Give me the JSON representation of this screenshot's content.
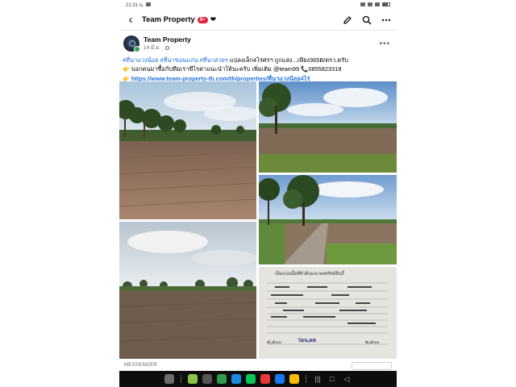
{
  "status_bar": {
    "time": "21:31 น."
  },
  "app_bar": {
    "title": "Team Property",
    "badge": "9+",
    "heart": "❤"
  },
  "post": {
    "author": "Team Property",
    "date": "14 มิ.ย.",
    "more": "•••",
    "hashtags": [
      "#ที่นาแวงน้อย",
      "#ที่นาขอนแก่น",
      "#ที่นาสวยๆ"
    ],
    "line1_text": " แปลงเล็ก4ไร่ศรฯ ถูกแสง...เพียง365B/ตรว.ครับ",
    "line2_prefix": "👉",
    "line2_text": "บอกคนมาซื้อกับทีมเราขีไรค่าแนะนำให้นะครับ เพิ่มเติม",
    "line2_contact": "@team99 📞0855823318",
    "line3_prefix": "👉",
    "link": "https://www.team-property-th.com/th/properties/ที่นาแวงน้อย4ไร่"
  },
  "messenger_label": "MESSENGER",
  "document_photo": {
    "heading": "เอ็มแบ่งเนื้อที่ตัวดินและพลทรัพย์สินธิ์",
    "value1": "๔,๔๐๐",
    "value2": "๒,๔๐๐",
    "stamp": "ว่อน,ผล"
  },
  "taskbar": {
    "apps": [
      {
        "icon": "grid-icon",
        "color": "#6c6c6c"
      },
      {
        "icon": "android-icon",
        "color": "#8bc34a"
      },
      {
        "icon": "camera-icon",
        "color": "#555555"
      },
      {
        "icon": "shield-icon",
        "color": "#2e9b4a"
      },
      {
        "icon": "files-icon",
        "color": "#1e88e5"
      },
      {
        "icon": "line-icon",
        "color": "#06c755"
      },
      {
        "icon": "chrome-icon",
        "color": "#e53935"
      },
      {
        "icon": "facebook-icon",
        "color": "#1877f2"
      },
      {
        "icon": "maps-icon",
        "color": "#fbbc05"
      }
    ]
  }
}
